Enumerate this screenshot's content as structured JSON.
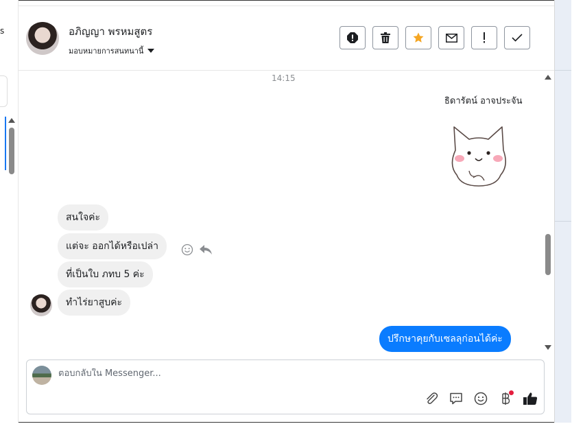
{
  "sidebar": {
    "fragment": "s"
  },
  "header": {
    "contact_name": "อภิญญา พรหมสูตร",
    "assign_label": "มอบหมายการสนทนานี้",
    "buttons": [
      "spam-icon",
      "trash-icon",
      "star-icon",
      "mail-icon",
      "exclamation-icon",
      "check-icon"
    ],
    "star_color": "#f5a623"
  },
  "conversation": {
    "timestamp": "14:15",
    "sender_name": "ธิดารัตน์ อาจประจัน",
    "sticker": "cat-sticker",
    "incoming": [
      "สนใจค่ะ",
      "แต่จะ ออกได้หรือเปล่า",
      "ที่เป็นใบ ภทบ 5 ค่ะ",
      "ทำไร่ยาสูบค่ะ"
    ],
    "outgoing": [
      "ปรึกษาคุยกับเซลลุก่อนได้ค่ะ"
    ],
    "outgoing_color": "#0a7cff"
  },
  "composer": {
    "placeholder": "ตอบกลับใน Messenger...",
    "value": "",
    "tools": [
      "attach-icon",
      "saved-reply-icon",
      "emoji-icon",
      "baht-icon",
      "like-icon"
    ]
  }
}
